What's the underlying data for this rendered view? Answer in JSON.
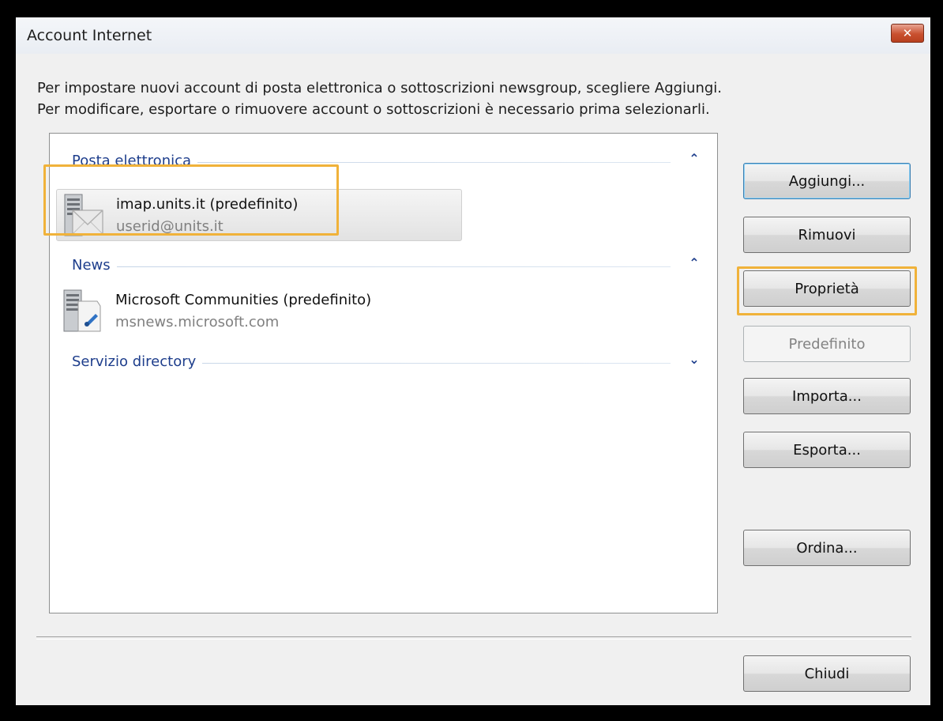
{
  "window": {
    "title": "Account Internet",
    "close_label": "x"
  },
  "description": {
    "line1": "Per impostare nuovi account di posta elettronica o sottoscrizioni newsgroup, scegliere Aggiungi.",
    "line2": "Per modificare, esportare o rimuovere account o sottoscrizioni è necessario prima selezionarli."
  },
  "list": {
    "groups": [
      {
        "label": "Posta elettronica",
        "chevron": "^",
        "items": [
          {
            "name": "imap.units.it (predefinito)",
            "detail": "userid@units.it",
            "icon": "mail-server-icon",
            "selected": true
          }
        ]
      },
      {
        "label": "News",
        "chevron": "^",
        "items": [
          {
            "name": "Microsoft Communities (predefinito)",
            "detail": "msnews.microsoft.com",
            "icon": "news-server-icon",
            "selected": false
          }
        ]
      },
      {
        "label": "Servizio directory",
        "chevron": "v",
        "items": []
      }
    ]
  },
  "buttons": {
    "add": "Aggiungi...",
    "remove": "Rimuovi",
    "properties": "Proprietà",
    "set_default": "Predefinito",
    "import": "Importa...",
    "export": "Esporta...",
    "order": "Ordina...",
    "close": "Chiudi"
  },
  "colors": {
    "highlight": "#f0b23a",
    "group_header": "#1e3e8c"
  }
}
